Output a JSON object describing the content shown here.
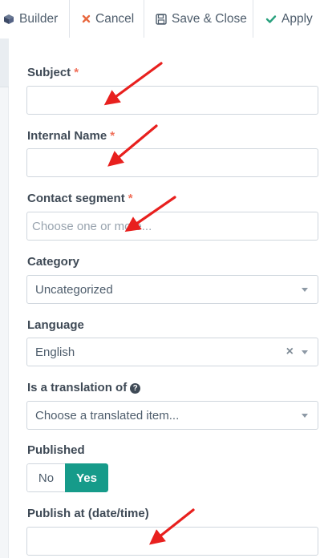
{
  "toolbar": {
    "builder_label": "Builder",
    "cancel_label": "Cancel",
    "save_close_label": "Save & Close",
    "apply_label": "Apply"
  },
  "form": {
    "subject": {
      "label": "Subject",
      "required": "*",
      "value": ""
    },
    "internal_name": {
      "label": "Internal Name",
      "required": "*",
      "value": ""
    },
    "contact_segment": {
      "label": "Contact segment",
      "required": "*",
      "placeholder": "Choose one or more..."
    },
    "category": {
      "label": "Category",
      "selected": "Uncategorized"
    },
    "language": {
      "label": "Language",
      "selected": "English",
      "clear": "×"
    },
    "translation_of": {
      "label": "Is a translation of",
      "help": "?",
      "placeholder": "Choose a translated item..."
    },
    "published": {
      "label": "Published",
      "no_label": "No",
      "yes_label": "Yes",
      "value": "Yes"
    },
    "publish_at": {
      "label": "Publish at (date/time)",
      "value": ""
    }
  },
  "colors": {
    "accent_green": "#169b8a",
    "required_red": "#f0705a",
    "cancel_red": "#e8683f",
    "apply_green": "#28a07d",
    "annotation_arrow": "#e8201e"
  },
  "icons": [
    "cube-icon",
    "close-icon",
    "save-icon",
    "check-icon",
    "chevron-down-icon",
    "clear-icon",
    "question-circle-icon",
    "annotation-arrow"
  ]
}
